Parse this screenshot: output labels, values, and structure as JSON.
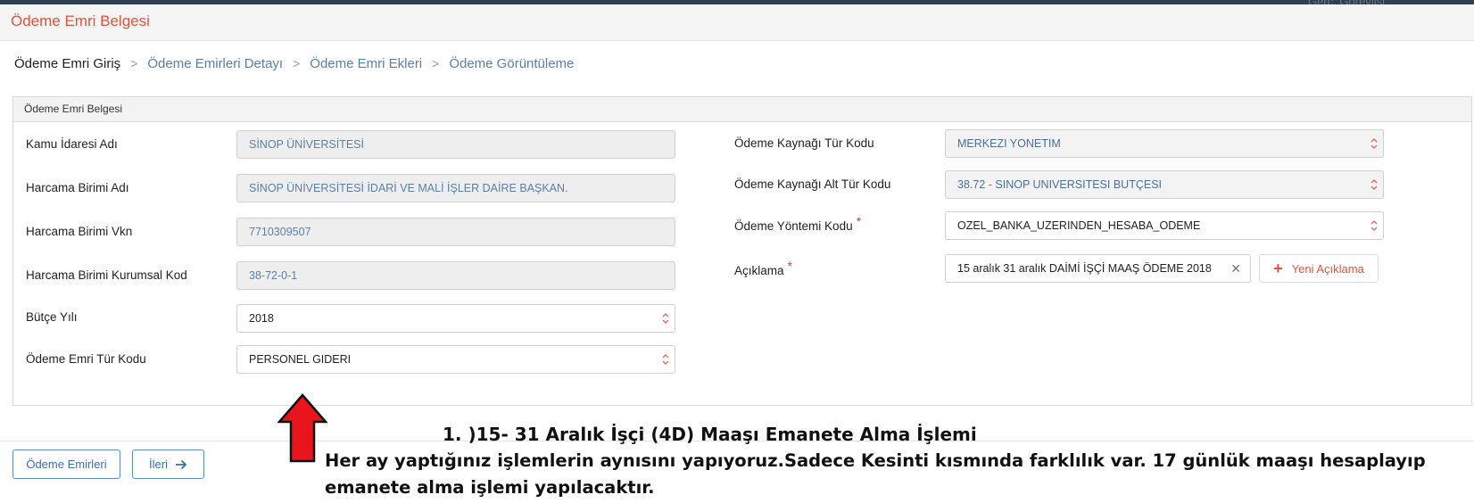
{
  "topbar": {
    "text": "Gerç. Görevlisi"
  },
  "header": {
    "title": "Ödeme Emri Belgesi"
  },
  "breadcrumb": {
    "items": [
      "Ödeme Emri Giriş",
      "Ödeme Emirleri Detayı",
      "Ödeme Emri Ekleri",
      "Ödeme Görüntüleme"
    ],
    "separator": ">"
  },
  "panel": {
    "title": "Ödeme Emri Belgesi",
    "left": [
      {
        "label": "Kamu İdaresi Adı",
        "value": "SİNOP ÜNİVERSİTESİ"
      },
      {
        "label": "Harcama Birimi Adı",
        "value": "SİNOP ÜNİVERSİTESİ İDARİ VE MALİ İŞLER DAİRE BAŞKAN."
      },
      {
        "label": "Harcama Birimi Vkn",
        "value": "7710309507"
      },
      {
        "label": "Harcama Birimi Kurumsal Kod",
        "value": "38-72-0-1"
      },
      {
        "label": "Bütçe Yılı",
        "value": "2018"
      },
      {
        "label": "Ödeme Emri Tür Kodu",
        "value": "PERSONEL GIDERI"
      }
    ],
    "right": [
      {
        "label": "Ödeme Kaynağı Tür Kodu",
        "value": "MERKEZI YONETIM"
      },
      {
        "label": "Ödeme Kaynağı Alt Tür Kodu",
        "value": "38.72 - SINOP UNIVERSITESI BUTÇESI"
      },
      {
        "label": "Ödeme Yöntemi Kodu",
        "value": "OZEL_BANKA_UZERINDEN_HESABA_ODEME"
      },
      {
        "label": "Açıklama",
        "value": "15 aralık 31 aralık DAİMİ İŞÇİ MAAŞ ÖDEME 2018"
      }
    ],
    "required_mark": "*",
    "new_description_button": "Yeni Açıklama"
  },
  "footer": {
    "list_button": "Ödeme Emirleri",
    "next_button": "İleri"
  },
  "annotation": {
    "title": "1. )15- 31 Aralık İşçi (4D) Maaşı Emanete Alma İşlemi",
    "body": "Her ay yaptığınız işlemlerin aynısını yapıyoruz.Sadece Kesinti kısmında farklılık var. 17 günlük maaşı hesaplayıp emanete alma işlemi yapılacaktır."
  },
  "colors": {
    "accent": "#e2533b",
    "link": "#5b7fa6",
    "arrow": "#e8161c"
  }
}
